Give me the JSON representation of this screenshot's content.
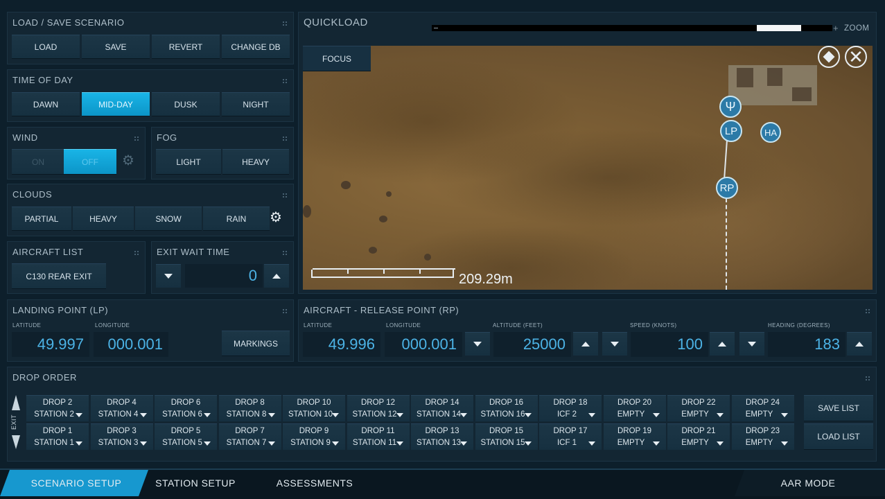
{
  "load_save": {
    "title": "LOAD / SAVE SCENARIO",
    "buttons": [
      "LOAD",
      "SAVE",
      "REVERT",
      "CHANGE DB"
    ]
  },
  "time_of_day": {
    "title": "TIME OF DAY",
    "buttons": [
      "DAWN",
      "MID-DAY",
      "DUSK",
      "NIGHT"
    ],
    "selected": "MID-DAY"
  },
  "wind": {
    "title": "WIND",
    "on": "ON",
    "off": "OFF"
  },
  "fog": {
    "title": "FOG",
    "buttons": [
      "LIGHT",
      "HEAVY"
    ]
  },
  "clouds": {
    "title": "CLOUDS",
    "buttons": [
      "PARTIAL",
      "HEAVY",
      "SNOW",
      "RAIN"
    ]
  },
  "aircraft_list": {
    "title": "AIRCRAFT LIST",
    "selected": "C130 REAR EXIT"
  },
  "exit_wait": {
    "title": "EXIT WAIT TIME",
    "value": "0"
  },
  "quickload": {
    "title": "QUICKLOAD",
    "zoom_label": "ZOOM",
    "zoom_level": 0.93,
    "focus": "FOCUS",
    "scale": "209.29m",
    "markers": {
      "lp": "LP",
      "rp": "RP",
      "ha": "HA"
    }
  },
  "landing_point": {
    "title": "LANDING POINT (LP)",
    "lat_label": "LATITUDE",
    "lon_label": "LONGITUDE",
    "lat": "49.997",
    "lon": "000.001",
    "markings": "MARKINGS"
  },
  "release_point": {
    "title": "AIRCRAFT - RELEASE POINT (RP)",
    "lat_label": "LATITUDE",
    "lon_label": "LONGITUDE",
    "alt_label": "ALTITUDE (FEET)",
    "spd_label": "SPEED (KNOTS)",
    "hdg_label": "HEADING (DEGREES)",
    "lat": "49.996",
    "lon": "000.001",
    "alt": "25000",
    "spd": "100",
    "hdg": "183"
  },
  "drop_order": {
    "title": "DROP ORDER",
    "exit_label": "EXIT",
    "top": [
      [
        "DROP 2",
        "STATION 2"
      ],
      [
        "DROP 4",
        "STATION 4"
      ],
      [
        "DROP 6",
        "STATION 6"
      ],
      [
        "DROP 8",
        "STATION 8"
      ],
      [
        "DROP 10",
        "STATION 10"
      ],
      [
        "DROP 12",
        "STATION 12"
      ],
      [
        "DROP 14",
        "STATION 14"
      ],
      [
        "DROP 16",
        "STATION 16"
      ],
      [
        "DROP 18",
        "ICF 2"
      ],
      [
        "DROP 20",
        "EMPTY"
      ],
      [
        "DROP 22",
        "EMPTY"
      ],
      [
        "DROP 24",
        "EMPTY"
      ]
    ],
    "bottom": [
      [
        "DROP 1",
        "STATION 1"
      ],
      [
        "DROP 3",
        "STATION 3"
      ],
      [
        "DROP 5",
        "STATION 5"
      ],
      [
        "DROP 7",
        "STATION 7"
      ],
      [
        "DROP 9",
        "STATION 9"
      ],
      [
        "DROP 11",
        "STATION 11"
      ],
      [
        "DROP 13",
        "STATION 13"
      ],
      [
        "DROP 15",
        "STATION 15"
      ],
      [
        "DROP 17",
        "ICF 1"
      ],
      [
        "DROP 19",
        "EMPTY"
      ],
      [
        "DROP 21",
        "EMPTY"
      ],
      [
        "DROP 23",
        "EMPTY"
      ]
    ],
    "save_list": "SAVE LIST",
    "load_list": "LOAD LIST"
  },
  "tabs": {
    "scenario": "SCENARIO SETUP",
    "station": "STATION SETUP",
    "assess": "ASSESSMENTS",
    "aar": "AAR MODE"
  },
  "colors": {
    "accent": "#14a8dd",
    "value": "#4cb3e6"
  }
}
